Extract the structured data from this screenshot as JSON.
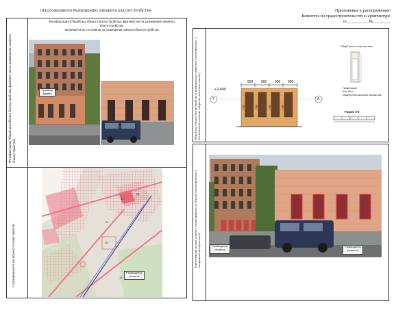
{
  "left_sheet": {
    "title": "ПРЕДЛОЖЕНИЯ ПО РАЗМЕЩЕНИЮ ЭЛЕМЕНТА БЛАГОУСТРОЙСТВА",
    "photo_section": {
      "side_label": "Фотофиксация (Общий вид объекта благоустройства, фрагмент места размещения элемента благоустройства)",
      "header_line1": "Фотофиксация (Общий вид объекта благоустройства, фрагмент места размещения элемента благоустройства)",
      "header_line2": "заполняется по состоянию до размещения элемента благоустройства",
      "callout": "Граница здания"
    },
    "map_section": {
      "side_label": "Ситуационный план объекта благоустройства",
      "numbers": [
        "19",
        "23",
        "21",
        "25",
        "16"
      ],
      "callout": "Размещение решеток"
    }
  },
  "header_right": {
    "line1": "Приложение к распоряжению",
    "line2": "Комитета по градостроительству и архитектуре",
    "line3": "от__________№________"
  },
  "facade_sheet": {
    "side_label": "Общий вид объекта благоустройства (с размещенным элементом благоустройства, с обозначением основных габаритов, высотных отметок)",
    "elevation": "+2,400",
    "dims_top": [
      "900",
      "900",
      "900",
      "900"
    ],
    "dims_side": [
      "1300",
      "1300",
      "1300",
      "1300"
    ],
    "axis_left": "7",
    "axis_right": "А",
    "detail_title": "Общий регион и признак окон",
    "notes": [
      "Примечание:",
      "RAL 8014",
      "Общий регион окрытия и признак окон"
    ],
    "section_label": "Разрез 0-0"
  },
  "collage_sheet": {
    "side_label": "Компьютерный коллаж элемента благоустройства на объекте благоустройства (с панорамным фотофиксации)",
    "callout_left": "Размещение решеток",
    "callout_right": "Размещение решеток"
  },
  "colors": {
    "brick": "#c98a6a",
    "grille_red": "#e0393f",
    "map_bg": "#e8e4dc",
    "map_pink": "#f3a6b2",
    "map_green": "#cfd8b8"
  }
}
